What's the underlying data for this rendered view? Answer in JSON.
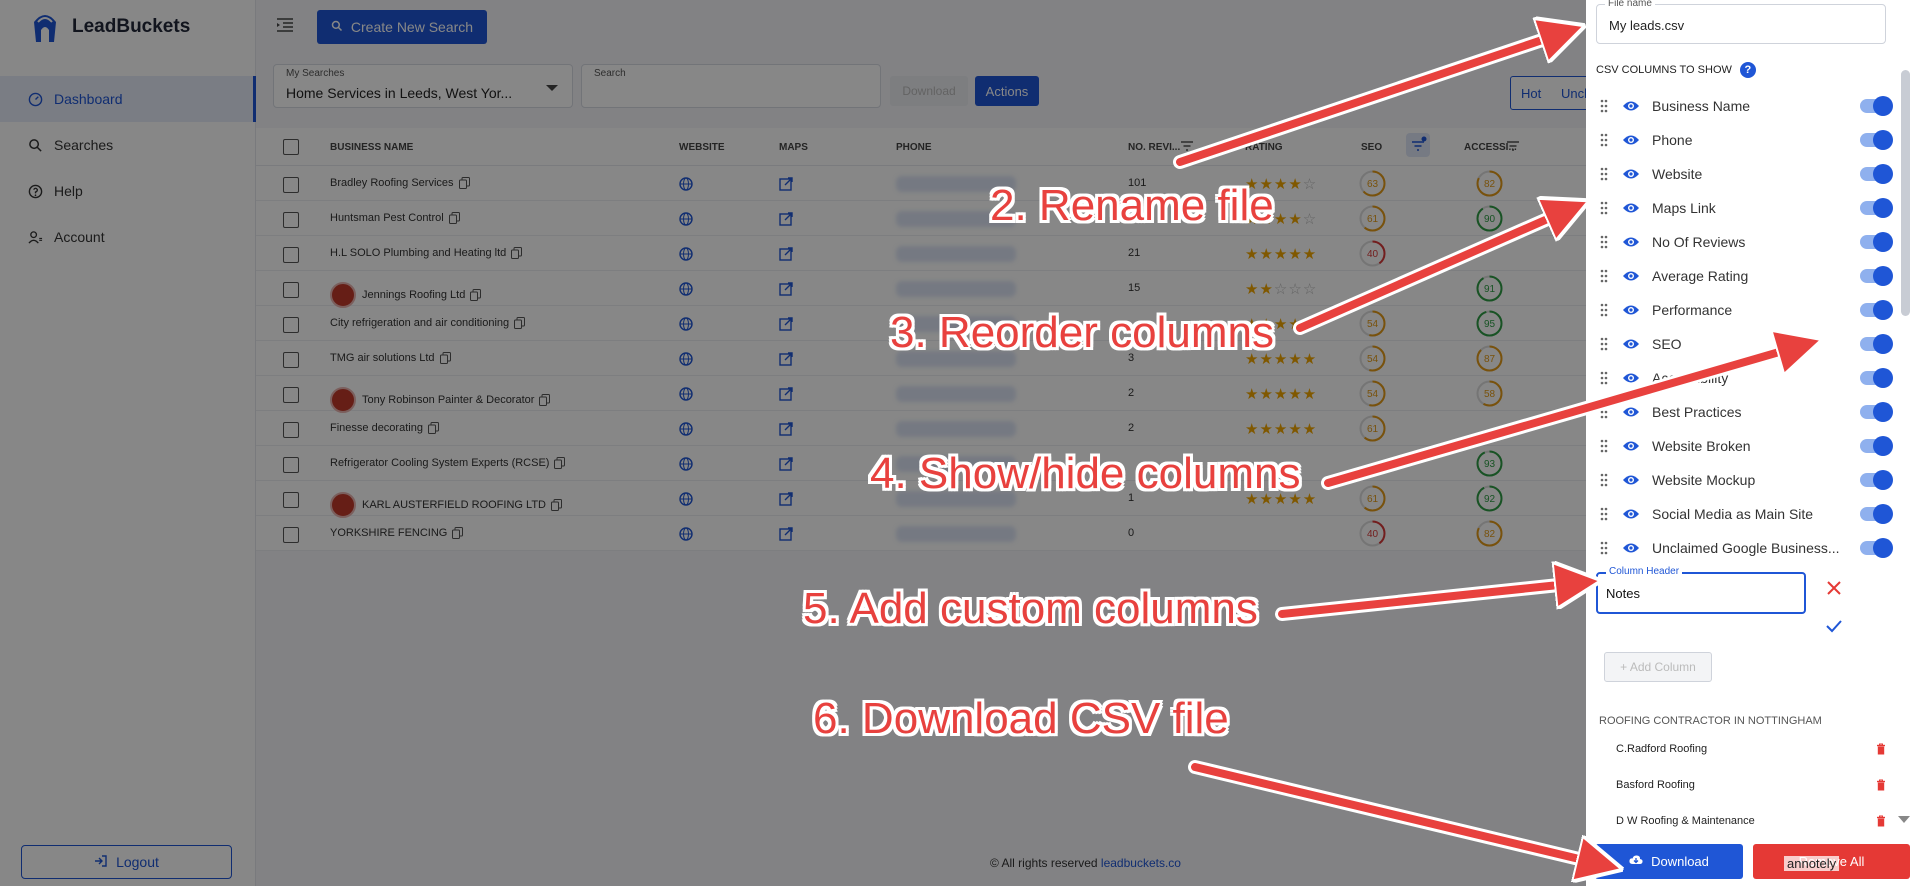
{
  "app": {
    "name": "LeadBuckets"
  },
  "sidebar": {
    "items": [
      {
        "label": "Dashboard",
        "icon": "dashboard-icon",
        "active": true
      },
      {
        "label": "Searches",
        "icon": "search-icon"
      },
      {
        "label": "Help",
        "icon": "help-icon"
      },
      {
        "label": "Account",
        "icon": "account-icon"
      }
    ],
    "logout_label": "Logout"
  },
  "topbar": {
    "create_label": "Create New Search"
  },
  "filters": {
    "my_searches_label": "My Searches",
    "my_searches_value": "Home Services in Leeds, West Yor...",
    "search_label": "Search",
    "download_label": "Download",
    "actions_label": "Actions",
    "segments": [
      "Hot",
      "Uncl"
    ]
  },
  "table": {
    "headers": {
      "business": "BUSINESS NAME",
      "website": "WEBSITE",
      "maps": "MAPS",
      "phone": "PHONE",
      "reviews": "NO. REVI...",
      "rating": "RATING",
      "seo": "SEO",
      "accessibility": "ACCESSI..."
    },
    "rows": [
      {
        "name": "Bradley Roofing Services",
        "reviews": "101",
        "stars": 4,
        "seo": 63,
        "acc": 82,
        "avatar": false
      },
      {
        "name": "Huntsman Pest Control",
        "reviews": "",
        "stars": 4,
        "seo": 61,
        "acc": 90,
        "avatar": false
      },
      {
        "name": "H.L SOLO Plumbing and Heating ltd",
        "reviews": "21",
        "stars": 5,
        "seo": 40,
        "acc": null,
        "avatar": false
      },
      {
        "name": "Jennings Roofing Ltd",
        "reviews": "15",
        "stars": 2,
        "seo": null,
        "acc": 91,
        "avatar": true
      },
      {
        "name": "City refrigeration and air conditioning",
        "reviews": "",
        "stars": 5,
        "seo": 54,
        "acc": 95,
        "avatar": false
      },
      {
        "name": "TMG air solutions Ltd",
        "reviews": "3",
        "stars": 5,
        "seo": 54,
        "acc": 87,
        "avatar": false
      },
      {
        "name": "Tony Robinson Painter & Decorator",
        "reviews": "2",
        "stars": 5,
        "seo": 54,
        "acc": 58,
        "avatar": true
      },
      {
        "name": "Finesse decorating",
        "reviews": "2",
        "stars": 5,
        "seo": 61,
        "acc": null,
        "avatar": false
      },
      {
        "name": "Refrigerator Cooling System Experts (RCSE)",
        "reviews": "",
        "stars": 0,
        "seo": null,
        "acc": 93,
        "avatar": false
      },
      {
        "name": "KARL AUSTERFIELD ROOFING LTD",
        "reviews": "1",
        "stars": 5,
        "seo": 61,
        "acc": 92,
        "avatar": true
      },
      {
        "name": "YORKSHIRE FENCING",
        "reviews": "0",
        "stars": 0,
        "seo": 40,
        "acc": 82,
        "avatar": false
      }
    ]
  },
  "footer": {
    "text": "© All rights reserved",
    "link": "leadbuckets.co"
  },
  "panel": {
    "file_name_label": "File name",
    "file_name_value": "My leads.csv",
    "csv_columns_title": "CSV COLUMNS TO SHOW",
    "help_glyph": "?",
    "columns": [
      "Business Name",
      "Phone",
      "Website",
      "Maps Link",
      "No Of Reviews",
      "Average Rating",
      "Performance",
      "SEO",
      "Accessibility",
      "Best Practices",
      "Website Broken",
      "Website Mockup",
      "Social Media as Main Site",
      "Unclaimed Google Business..."
    ],
    "column_header_label": "Column Header",
    "column_header_value": "Notes",
    "add_column_label": "+ Add Column",
    "saved_title": "ROOFING CONTRACTOR IN NOTTINGHAM",
    "saved_items": [
      "C.Radford Roofing",
      "Basford Roofing",
      "D W Roofing & Maintenance"
    ],
    "download_label": "Download",
    "clear_label": "Remove All"
  },
  "annotations": [
    "2. Rename file",
    "3. Reorder columns",
    "4. Show/hide columns",
    "5. Add custom columns",
    "6. Download CSV file"
  ],
  "watermark": "annotely",
  "colors": {
    "primary": "#1f56d6",
    "danger": "#e53935",
    "annotation": "#e8413e",
    "star": "#f2a600"
  }
}
